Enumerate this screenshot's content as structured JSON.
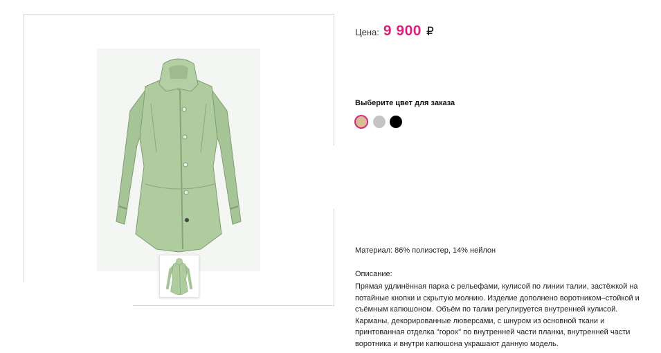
{
  "product": {
    "price_label": "Цена:",
    "price_value": "9 900",
    "price_currency": "₽",
    "color_title": "Выберите цвет для заказа",
    "colors": [
      {
        "name": "beige",
        "hex": "#d7bc94",
        "selected": true
      },
      {
        "name": "gray",
        "hex": "#c4c4c4",
        "selected": false
      },
      {
        "name": "black",
        "hex": "#000000",
        "selected": false
      }
    ],
    "material": "Материал: 86% полиэстер, 14% нейлон",
    "description_label": "Описание:",
    "description_text": "Прямая удлинённая парка с рельефами, кулисой по линии талии, застёжкой на потайные кнопки и скрытую молнию. Изделие дополнено воротником–стойкой и съёмным капюшоном. Объём по талии регулируется внутренней кулисой. Карманы, декорированные люверсами, с шнуром из основной ткани и принтованная отделка \"горох\" по внутренней части планки, внутренней части воротника и внутри капюшона украшают данную модель."
  },
  "gallery": {
    "main_image_icon": "jacket-photo",
    "thumb_icon": "jacket-photo-thumbnail",
    "jacket_color": "#a9c79a"
  },
  "accent_color": "#d6247f"
}
